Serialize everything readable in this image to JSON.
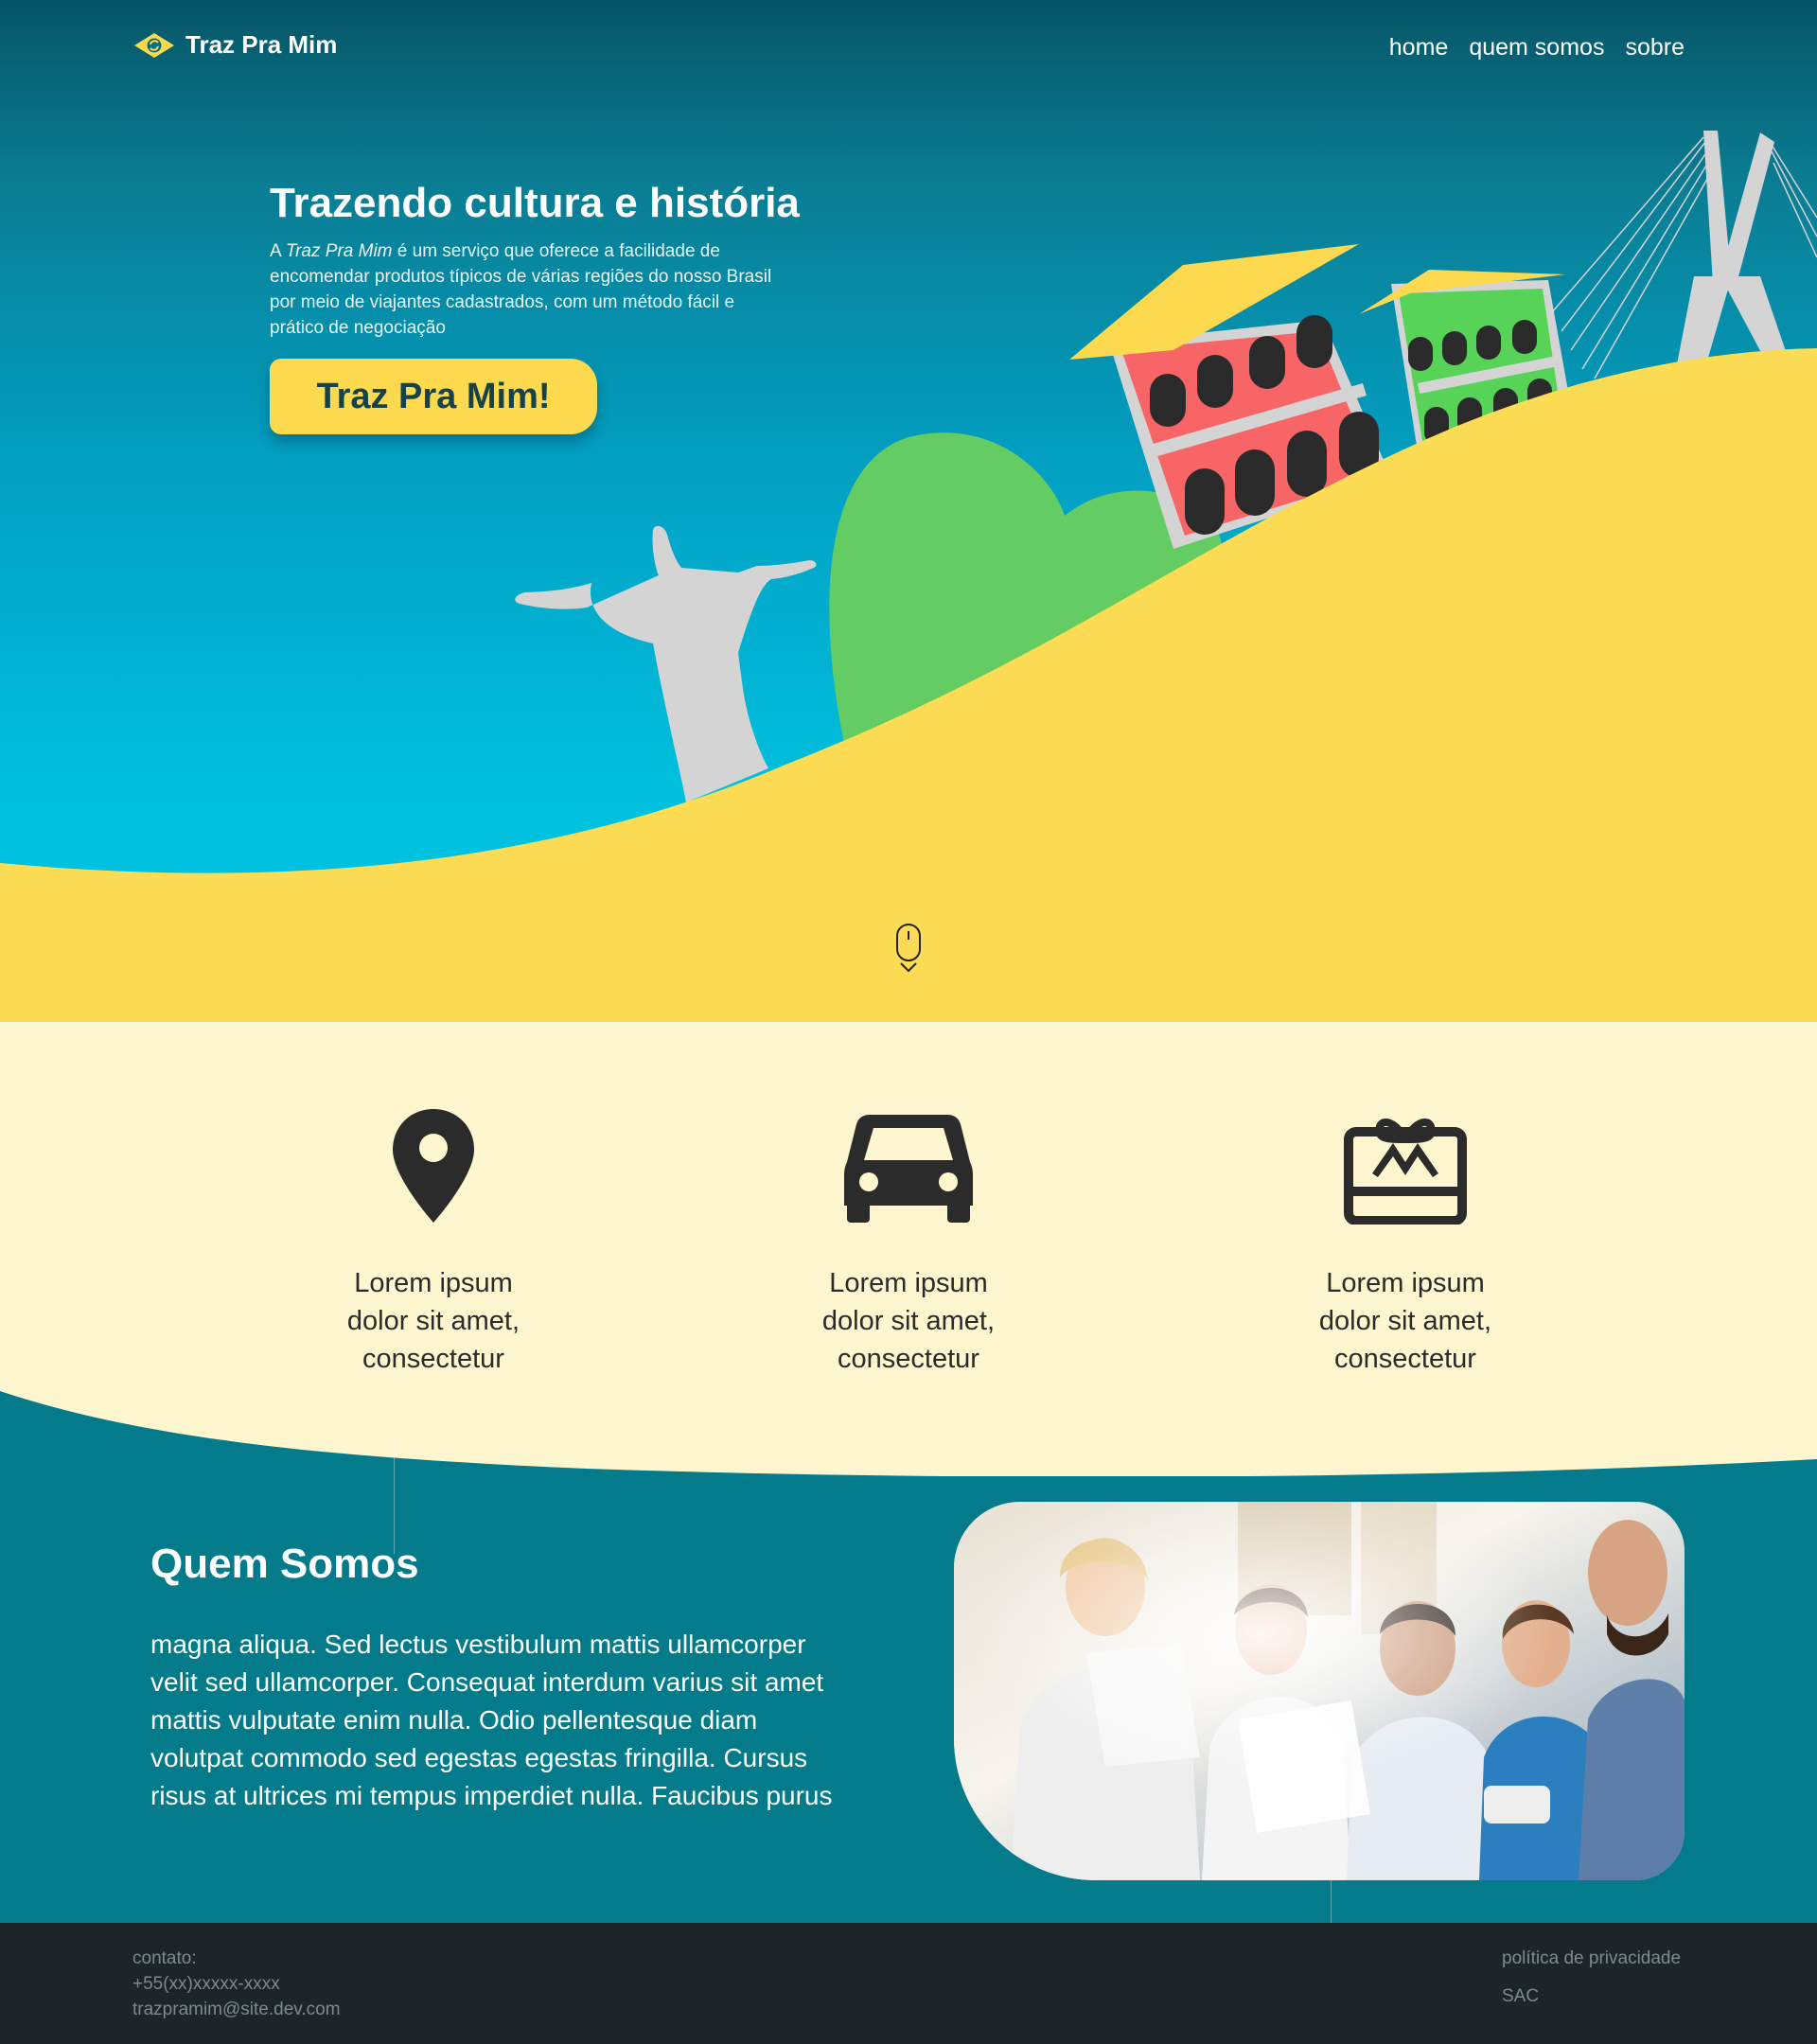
{
  "header": {
    "brand": "Traz Pra Mim",
    "nav": [
      "home",
      "quem somos",
      "sobre"
    ]
  },
  "hero": {
    "title": "Trazendo cultura e história",
    "desc_prefix": "A ",
    "desc_brand": "Traz Pra Mim",
    "desc_rest": " é um serviço que oferece a facilidade de encomendar produtos típicos de várias regiões do nosso Brasil por meio de viajantes cadastrados, com um método fácil e prático de negociação",
    "cta_label": "Traz Pra Mim!"
  },
  "features": [
    {
      "icon": "map-pin-icon",
      "line1": "Lorem ipsum",
      "line2": "dolor sit amet,",
      "line3": "consectetur"
    },
    {
      "icon": "car-icon",
      "line1": "Lorem ipsum",
      "line2": "dolor sit amet,",
      "line3": "consectetur"
    },
    {
      "icon": "gift-card-icon",
      "line1": "Lorem ipsum",
      "line2": "dolor sit amet,",
      "line3": "consectetur"
    }
  ],
  "about": {
    "title": "Quem Somos",
    "text": "  magna aliqua. Sed lectus vestibulum mattis ullamcorper velit sed ullamcorper. Consequat interdum varius sit amet mattis vulputate enim nulla. Odio pellentesque diam volutpat commodo sed egestas egestas fringilla. Cursus risus at ultrices mi tempus imperdiet nulla. Faucibus purus"
  },
  "footer": {
    "contact_label": "contato:",
    "phone": "+55(xx)xxxxx-xxxx",
    "email": "trazpramim@site.dev.com",
    "privacy": "política de privacidade",
    "sac": "SAC"
  },
  "colors": {
    "teal_dark": "#065566",
    "cyan": "#00c4e2",
    "yellow": "#fcd94f",
    "cream": "#fef6ce",
    "about_bg": "#037b8b",
    "footer_bg": "#1c2629"
  }
}
